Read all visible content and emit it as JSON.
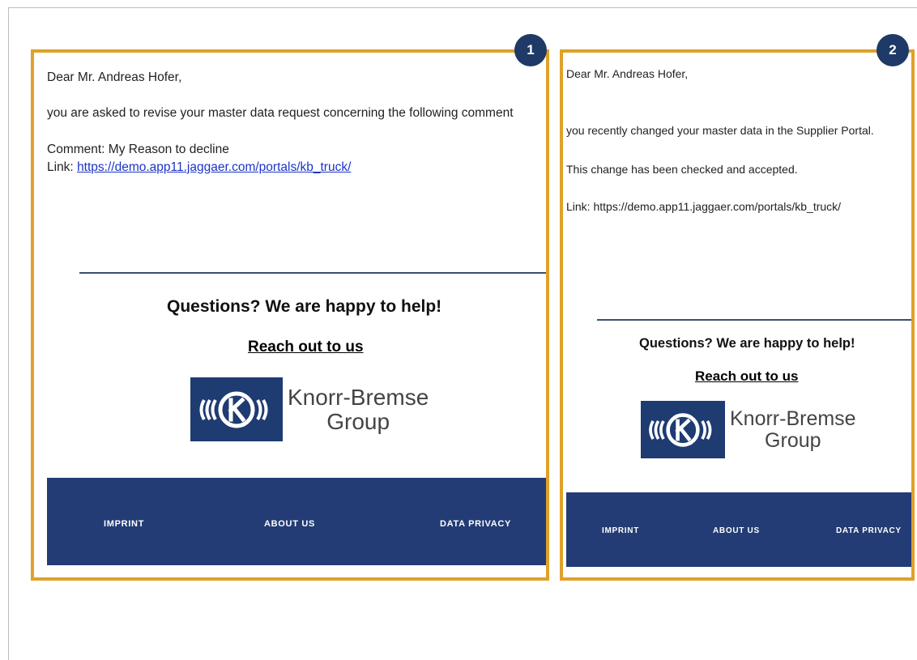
{
  "badges": [
    "1",
    "2"
  ],
  "email1": {
    "greeting": "Dear Mr. Andreas Hofer,",
    "body": "you are asked to revise your master data request concerning the following comment",
    "comment": "Comment: My Reason to decline",
    "link_label": "Link: ",
    "link_url": "https://demo.app11.jaggaer.com/portals/kb_truck/",
    "questions": "Questions? We are happy to help!",
    "reach_out": "Reach out to us",
    "logo_line1": "Knorr-Bremse",
    "logo_line2": "Group",
    "footer": {
      "imprint": "IMPRINT",
      "about": "ABOUT US",
      "privacy": "DATA PRIVACY"
    }
  },
  "email2": {
    "greeting": "Dear Mr. Andreas Hofer,",
    "body": "you recently changed your master data in the Supplier Portal.",
    "accepted": "This change has been checked and accepted.",
    "link": "Link: https://demo.app11.jaggaer.com/portals/kb_truck/",
    "questions": "Questions? We are happy to help!",
    "reach_out": "Reach out to us",
    "logo_line1": "Knorr-Bremse",
    "logo_line2": "Group",
    "footer": {
      "imprint": "IMPRINT",
      "about": "ABOUT US",
      "privacy": "DATA PRIVACY"
    }
  },
  "colors": {
    "highlight_border": "#e0a12a",
    "badge": "#1f3a66",
    "footer": "#233c75",
    "logo_box": "#1e3b72",
    "link": "#1a34c8"
  }
}
